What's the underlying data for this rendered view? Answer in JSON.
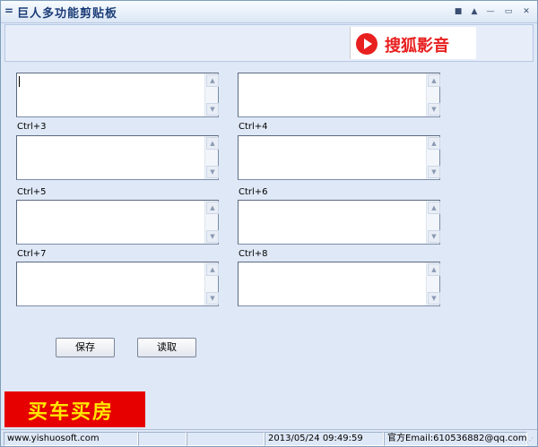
{
  "window": {
    "title": "巨人多功能剪贴板",
    "system_icon": "=",
    "controls": {
      "menu": "■",
      "roll": "▲",
      "minimize": "—",
      "maximize": "▭",
      "close": "✕"
    }
  },
  "top_ad": {
    "brand": "搜狐影音",
    "color": "#e8201f"
  },
  "slots": [
    {
      "label": "",
      "value": ""
    },
    {
      "label": "",
      "value": ""
    },
    {
      "label": "Ctrl+3",
      "value": ""
    },
    {
      "label": "Ctrl+4",
      "value": ""
    },
    {
      "label": "Ctrl+5",
      "value": ""
    },
    {
      "label": "Ctrl+6",
      "value": ""
    },
    {
      "label": "Ctrl+7",
      "value": ""
    },
    {
      "label": "Ctrl+8",
      "value": ""
    }
  ],
  "scroll_icons": {
    "up": "▲",
    "down": "▼"
  },
  "buttons": {
    "save": "保存",
    "read": "读取"
  },
  "bottom_ad": {
    "text": "买车买房",
    "bg": "#e60000",
    "fg": "#ffe600"
  },
  "status": {
    "website": "www.yishuosoft.com",
    "blank": "",
    "datetime": "2013/05/24 09:49:59",
    "email": "官方Email:610536882@qq.com",
    "grip": "⋰"
  }
}
